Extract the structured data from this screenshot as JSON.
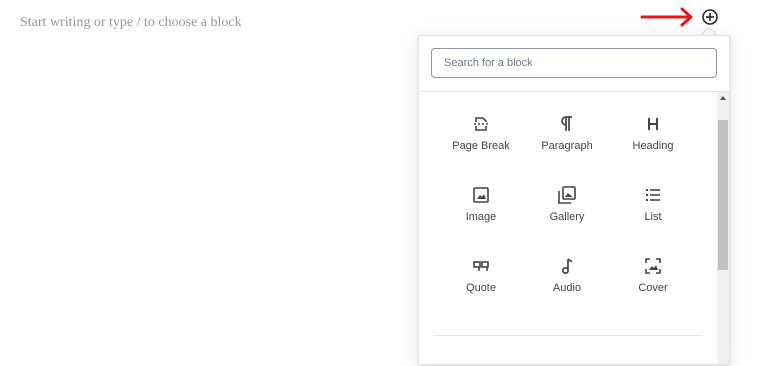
{
  "editor": {
    "placeholder": "Start writing or type / to choose a block"
  },
  "toolbar": {
    "add_block_icon": "plus-circle-icon",
    "annotation_arrow_color": "#e8161b"
  },
  "inserter": {
    "search": {
      "placeholder": "Search for a block",
      "value": ""
    },
    "blocks": [
      {
        "label": "Page Break",
        "icon": "page-break-icon"
      },
      {
        "label": "Paragraph",
        "icon": "paragraph-icon"
      },
      {
        "label": "Heading",
        "icon": "heading-icon"
      },
      {
        "label": "Image",
        "icon": "image-icon"
      },
      {
        "label": "Gallery",
        "icon": "gallery-icon"
      },
      {
        "label": "List",
        "icon": "list-icon"
      },
      {
        "label": "Quote",
        "icon": "quote-icon"
      },
      {
        "label": "Audio",
        "icon": "audio-icon"
      },
      {
        "label": "Cover",
        "icon": "cover-icon"
      }
    ]
  }
}
